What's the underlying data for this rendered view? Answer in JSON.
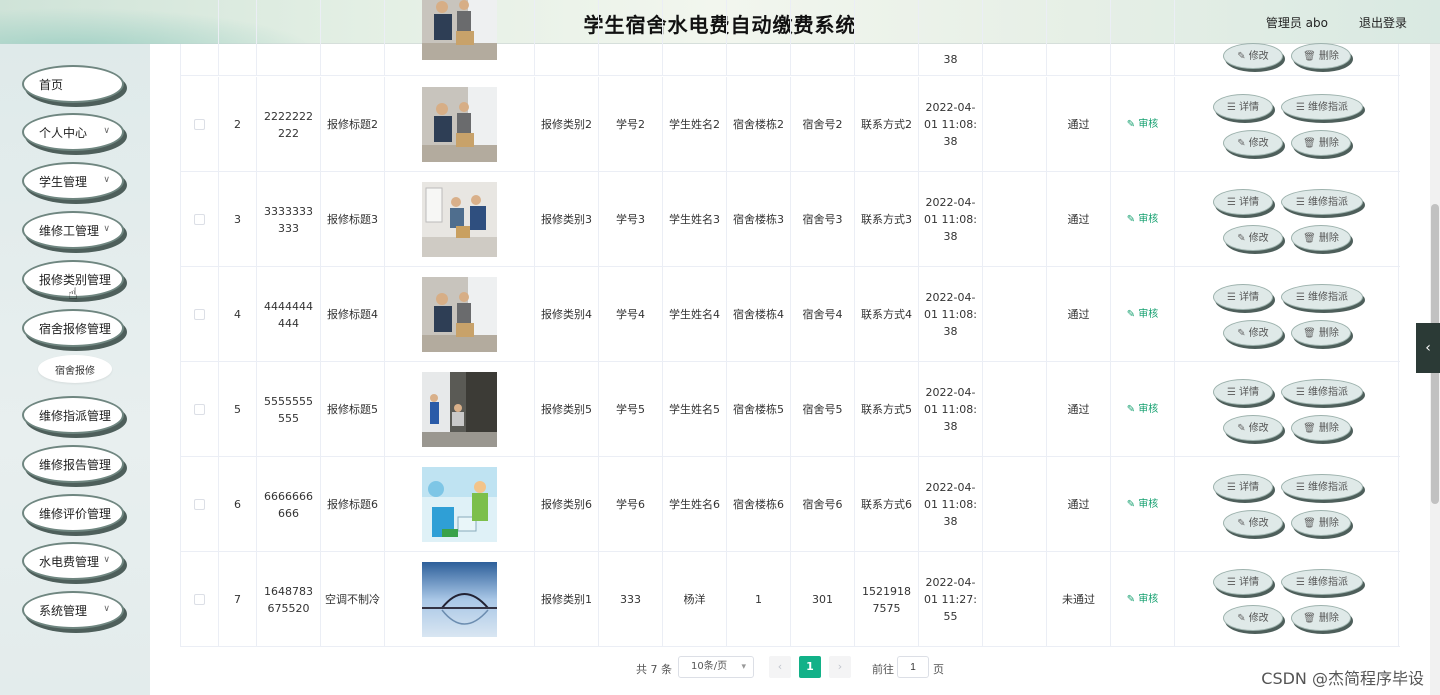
{
  "header": {
    "title": "学生宿舍水电费自动缴费系统",
    "user": "管理员 abo",
    "logout": "退出登录"
  },
  "sidebar": {
    "items": [
      {
        "label": "首页",
        "chevron": false
      },
      {
        "label": "个人中心",
        "chevron": true
      },
      {
        "label": "学生管理",
        "chevron": true
      },
      {
        "label": "维修工管理",
        "chevron": true
      },
      {
        "label": "报修类别管理",
        "chevron": false
      },
      {
        "label": "宿舍报修管理",
        "chevron": false
      },
      {
        "label": "维修指派管理",
        "chevron": false
      },
      {
        "label": "维修报告管理",
        "chevron": false
      },
      {
        "label": "维修评价管理",
        "chevron": false
      },
      {
        "label": "水电费管理",
        "chevron": true
      },
      {
        "label": "系统管理",
        "chevron": true
      }
    ],
    "sub_item": "宿舍报修"
  },
  "top_row": {
    "time_tail": "38",
    "edit": "修改",
    "delete": "删除"
  },
  "rows": [
    {
      "idx": "2",
      "no": "2222222222",
      "title": "报修标题2",
      "category": "报修类别2",
      "student_no": "学号2",
      "student_name": "学生姓名2",
      "building": "宿舍楼栋2",
      "room": "宿舍号2",
      "contact": "联系方式2",
      "time": "2022-04-01 11:08:38",
      "status": "通过",
      "image": "repair-photo-a"
    },
    {
      "idx": "3",
      "no": "3333333333",
      "title": "报修标题3",
      "category": "报修类别3",
      "student_no": "学号3",
      "student_name": "学生姓名3",
      "building": "宿舍楼栋3",
      "room": "宿舍号3",
      "contact": "联系方式3",
      "time": "2022-04-01 11:08:38",
      "status": "通过",
      "image": "repair-photo-b"
    },
    {
      "idx": "4",
      "no": "4444444444",
      "title": "报修标题4",
      "category": "报修类别4",
      "student_no": "学号4",
      "student_name": "学生姓名4",
      "building": "宿舍楼栋4",
      "room": "宿舍号4",
      "contact": "联系方式4",
      "time": "2022-04-01 11:08:38",
      "status": "通过",
      "image": "repair-photo-a"
    },
    {
      "idx": "5",
      "no": "5555555555",
      "title": "报修标题5",
      "category": "报修类别5",
      "student_no": "学号5",
      "student_name": "学生姓名5",
      "building": "宿舍楼栋5",
      "room": "宿舍号5",
      "contact": "联系方式5",
      "time": "2022-04-01 11:08:38",
      "status": "通过",
      "image": "repair-photo-c"
    },
    {
      "idx": "6",
      "no": "6666666666",
      "title": "报修标题6",
      "category": "报修类别6",
      "student_no": "学号6",
      "student_name": "学生姓名6",
      "building": "宿舍楼栋6",
      "room": "宿舍号6",
      "contact": "联系方式6",
      "time": "2022-04-01 11:08:38",
      "status": "通过",
      "image": "repair-cartoon"
    },
    {
      "idx": "7",
      "no": "1648783675520",
      "title": "空调不制冷",
      "category": "报修类别1",
      "student_no": "333",
      "student_name": "杨洋",
      "building": "1",
      "room": "301",
      "contact": "15219187575",
      "time": "2022-04-01 11:27:55",
      "status": "未通过",
      "image": "bridge-photo"
    }
  ],
  "actions": {
    "audit": "审核",
    "detail": "详情",
    "assign": "维修指派",
    "edit": "修改",
    "delete": "删除"
  },
  "pagination": {
    "total": "共 7 条",
    "page_size": "10条/页",
    "current_page": "1",
    "goto_label": "前往",
    "goto_value": "1",
    "page_unit": "页"
  },
  "watermark": "CSDN @杰简程序毕设",
  "colors": {
    "accent": "#12b188",
    "audit": "#14a06f",
    "button_bg": "#dfe9e8",
    "button_shadow": "#4e5f5b"
  }
}
